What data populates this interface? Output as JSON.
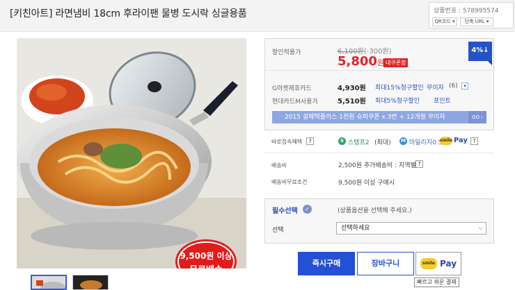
{
  "header": {
    "title": "[키친아트] 라면냄비 18cm 후라이팬 물병 도시락 싱글용품",
    "product_code_label": "상품번호 : 578995574",
    "qr_label": "QR코드",
    "short_url_label": "단축 URL"
  },
  "image": {
    "promo_badge_line1": "9,500원 이상",
    "promo_badge_line2": "무료배송"
  },
  "price": {
    "discount_label": "할인적용가",
    "original_text": "6,100원",
    "discount_text": "(-300원)",
    "sale_price": "5,800",
    "won": "원",
    "coupon_tag": "내쿠폰함",
    "rate_badge": "4%↓"
  },
  "cards": [
    {
      "label": "G마켓제휴카드",
      "amount": "4,930원",
      "benefit": "최대15%청구할인",
      "installment": "무이자",
      "months": "6"
    },
    {
      "label": "현대카드M사용가",
      "amount": "5,510원",
      "benefit": "최대5%청구할인",
      "extra": "포인트"
    }
  ],
  "promo_bar": {
    "text": "2015 설페텍플러스 1천원 슈퍼쿠폰 x 3번 + 12개월 무이자",
    "go": "GO"
  },
  "benefits": {
    "label": "바로접속혜택",
    "stamp": "스탬프2",
    "stamp_note": "(최대)",
    "mileage": "마일리지0.5%",
    "pay_label": "Pay"
  },
  "shipping": {
    "label": "배송비",
    "value": "2,500원 추가배송비 : 지역별",
    "free_label": "배송비무료조건",
    "free_value": "9,500원 이상 구매시"
  },
  "option": {
    "required_label": "필수선택",
    "hint": "(상품옵션을 선택해 주세요.)",
    "select_label": "선택",
    "select_value": "선택하세요"
  },
  "actions": {
    "buy": "즉시구매",
    "cart": "장바구니",
    "pay": "Pay",
    "smile": "smile",
    "tooltip": "빠르고 쉬운 결제"
  }
}
